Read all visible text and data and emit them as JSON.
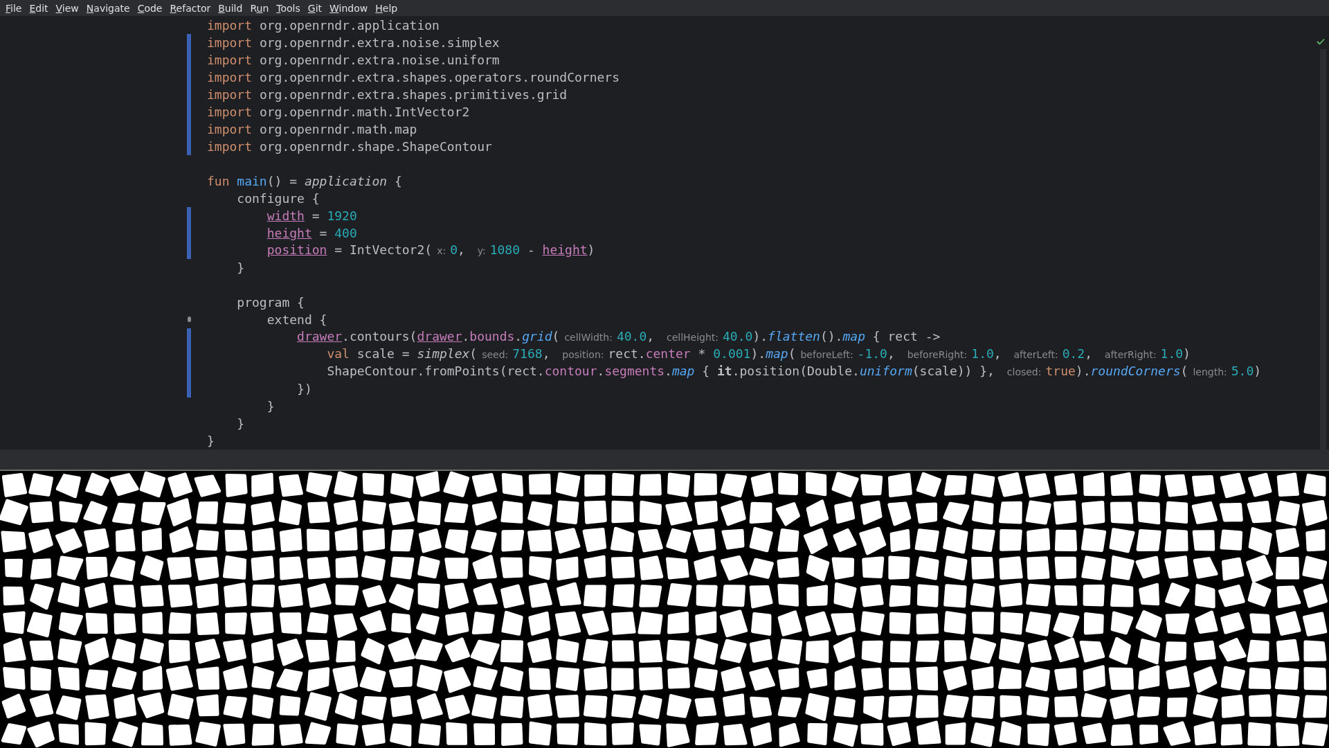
{
  "menu": [
    {
      "key": "F",
      "after": "ile"
    },
    {
      "key": "E",
      "after": "dit"
    },
    {
      "key": "V",
      "after": "iew"
    },
    {
      "key": "N",
      "after": "avigate"
    },
    {
      "key": "C",
      "after": "ode"
    },
    {
      "key": "R",
      "after": "efactor"
    },
    {
      "key": "B",
      "after": "uild"
    },
    {
      "before": "R",
      "key": "u",
      "after": "n"
    },
    {
      "key": "T",
      "after": "ools"
    },
    {
      "key": "G",
      "after": "it"
    },
    {
      "key": "W",
      "after": "indow"
    },
    {
      "key": "H",
      "after": "elp"
    }
  ],
  "editor": {
    "lines": [
      {
        "changed": false,
        "marked": false,
        "tokens": [
          {
            "kind": "kw",
            "text": "import"
          },
          {
            "kind": "plain",
            "text": " org.openrndr.application"
          }
        ]
      },
      {
        "changed": true,
        "marked": false,
        "tokens": [
          {
            "kind": "kw",
            "text": "import"
          },
          {
            "kind": "plain",
            "text": " org.openrndr.extra.noise.simplex"
          }
        ]
      },
      {
        "changed": true,
        "marked": false,
        "tokens": [
          {
            "kind": "kw",
            "text": "import"
          },
          {
            "kind": "plain",
            "text": " org.openrndr.extra.noise.uniform"
          }
        ]
      },
      {
        "changed": true,
        "marked": false,
        "tokens": [
          {
            "kind": "kw",
            "text": "import"
          },
          {
            "kind": "plain",
            "text": " org.openrndr.extra.shapes.operators.roundCorners"
          }
        ]
      },
      {
        "changed": true,
        "marked": false,
        "tokens": [
          {
            "kind": "kw",
            "text": "import"
          },
          {
            "kind": "plain",
            "text": " org.openrndr.extra.shapes.primitives.grid"
          }
        ]
      },
      {
        "changed": true,
        "marked": false,
        "tokens": [
          {
            "kind": "kw",
            "text": "import"
          },
          {
            "kind": "plain",
            "text": " org.openrndr.math.IntVector2"
          }
        ]
      },
      {
        "changed": true,
        "marked": false,
        "tokens": [
          {
            "kind": "kw",
            "text": "import"
          },
          {
            "kind": "plain",
            "text": " org.openrndr.math.map"
          }
        ]
      },
      {
        "changed": true,
        "marked": false,
        "tokens": [
          {
            "kind": "kw",
            "text": "import"
          },
          {
            "kind": "plain",
            "text": " org.openrndr.shape.ShapeContour"
          }
        ]
      },
      {
        "changed": false,
        "marked": false
      },
      {
        "changed": false,
        "marked": false,
        "tokens": [
          {
            "kind": "kw",
            "text": "fun"
          },
          {
            "kind": "fn",
            "text": " main"
          },
          {
            "kind": "plain",
            "text": "() = "
          },
          {
            "kind": "ital",
            "text": "application"
          },
          {
            "kind": "plain",
            "text": " {"
          }
        ]
      },
      {
        "changed": false,
        "marked": false,
        "tokens": [
          {
            "kind": "plain",
            "text": "    configure {"
          }
        ]
      },
      {
        "changed": true,
        "marked": false,
        "tokens": [
          {
            "kind": "prop",
            "text": "        width"
          },
          {
            "kind": "plain",
            "text": " = "
          },
          {
            "kind": "num",
            "text": "1920"
          }
        ]
      },
      {
        "changed": true,
        "marked": false,
        "tokens": [
          {
            "kind": "prop",
            "text": "        height"
          },
          {
            "kind": "plain",
            "text": " = "
          },
          {
            "kind": "num",
            "text": "400"
          }
        ]
      },
      {
        "changed": true,
        "marked": false,
        "tokens": [
          {
            "kind": "prop",
            "text": "        position"
          },
          {
            "kind": "plain",
            "text": " = IntVector2("
          },
          {
            "kind": "hint",
            "text": "x:"
          },
          {
            "kind": "num",
            "text": "0"
          },
          {
            "kind": "plain",
            "text": ", "
          },
          {
            "kind": "hint",
            "text": "y:"
          },
          {
            "kind": "num",
            "text": "1080"
          },
          {
            "kind": "plain",
            "text": " - "
          },
          {
            "kind": "prop",
            "text": "height"
          },
          {
            "kind": "plain",
            "text": ")"
          }
        ]
      },
      {
        "changed": false,
        "marked": false,
        "tokens": [
          {
            "kind": "plain",
            "text": "    }"
          }
        ]
      },
      {
        "changed": false,
        "marked": false
      },
      {
        "changed": false,
        "marked": false,
        "tokens": [
          {
            "kind": "plain",
            "text": "    program {"
          }
        ]
      },
      {
        "changed": false,
        "marked": true,
        "tokens": [
          {
            "kind": "plain",
            "text": "        extend {"
          }
        ]
      },
      {
        "changed": true,
        "marked": false,
        "tokens": [
          {
            "kind": "prop",
            "text": "            drawer"
          },
          {
            "kind": "plain",
            "text": ".contours("
          },
          {
            "kind": "prop",
            "text": "drawer"
          },
          {
            "kind": "plain",
            "text": "."
          },
          {
            "kind": "field",
            "text": "bounds"
          },
          {
            "kind": "plain",
            "text": "."
          },
          {
            "kind": "itfn",
            "text": "grid"
          },
          {
            "kind": "plain",
            "text": "("
          },
          {
            "kind": "hint",
            "text": "cellWidth:"
          },
          {
            "kind": "num",
            "text": "40.0"
          },
          {
            "kind": "plain",
            "text": ", "
          },
          {
            "kind": "hint",
            "text": "cellHeight:"
          },
          {
            "kind": "num",
            "text": "40.0"
          },
          {
            "kind": "plain",
            "text": ")."
          },
          {
            "kind": "itfn",
            "text": "flatten"
          },
          {
            "kind": "plain",
            "text": "()."
          },
          {
            "kind": "itfn",
            "text": "map"
          },
          {
            "kind": "plain",
            "text": " { rect ->"
          }
        ]
      },
      {
        "changed": true,
        "marked": false,
        "tokens": [
          {
            "kind": "kw",
            "text": "                val"
          },
          {
            "kind": "plain",
            "text": " scale = "
          },
          {
            "kind": "ital",
            "text": "simplex"
          },
          {
            "kind": "plain",
            "text": "("
          },
          {
            "kind": "hint",
            "text": "seed:"
          },
          {
            "kind": "num",
            "text": "7168"
          },
          {
            "kind": "plain",
            "text": ", "
          },
          {
            "kind": "hint",
            "text": "position:"
          },
          {
            "kind": "plain",
            "text": "rect."
          },
          {
            "kind": "field",
            "text": "center"
          },
          {
            "kind": "plain",
            "text": " * "
          },
          {
            "kind": "num",
            "text": "0.001"
          },
          {
            "kind": "plain",
            "text": ")."
          },
          {
            "kind": "itfn",
            "text": "map"
          },
          {
            "kind": "plain",
            "text": "("
          },
          {
            "kind": "hint",
            "text": "beforeLeft:"
          },
          {
            "kind": "num",
            "text": "-1.0"
          },
          {
            "kind": "plain",
            "text": ", "
          },
          {
            "kind": "hint",
            "text": "beforeRight:"
          },
          {
            "kind": "num",
            "text": "1.0"
          },
          {
            "kind": "plain",
            "text": ", "
          },
          {
            "kind": "hint",
            "text": "afterLeft:"
          },
          {
            "kind": "num",
            "text": "0.2"
          },
          {
            "kind": "plain",
            "text": ", "
          },
          {
            "kind": "hint",
            "text": "afterRight:"
          },
          {
            "kind": "num",
            "text": "1.0"
          },
          {
            "kind": "plain",
            "text": ")"
          }
        ]
      },
      {
        "changed": true,
        "marked": false,
        "tokens": [
          {
            "kind": "plain",
            "text": "                ShapeContour.fromPoints(rect."
          },
          {
            "kind": "field",
            "text": "contour"
          },
          {
            "kind": "plain",
            "text": "."
          },
          {
            "kind": "field",
            "text": "segments"
          },
          {
            "kind": "plain",
            "text": "."
          },
          {
            "kind": "itfn",
            "text": "map"
          },
          {
            "kind": "plain",
            "text": " { "
          },
          {
            "kind": "bold",
            "text": "it"
          },
          {
            "kind": "plain",
            "text": ".position(Double."
          },
          {
            "kind": "itfn",
            "text": "uniform"
          },
          {
            "kind": "plain",
            "text": "(scale)) }, "
          },
          {
            "kind": "hint",
            "text": "closed:"
          },
          {
            "kind": "kw",
            "text": "true"
          },
          {
            "kind": "plain",
            "text": ")."
          },
          {
            "kind": "itfn",
            "text": "roundCorners"
          },
          {
            "kind": "plain",
            "text": "("
          },
          {
            "kind": "hint",
            "text": "length:"
          },
          {
            "kind": "num",
            "text": "5.0"
          },
          {
            "kind": "plain",
            "text": ")"
          }
        ]
      },
      {
        "changed": true,
        "marked": false,
        "tokens": [
          {
            "kind": "plain",
            "text": "            })"
          }
        ]
      },
      {
        "changed": false,
        "marked": false,
        "tokens": [
          {
            "kind": "plain",
            "text": "        }"
          }
        ]
      },
      {
        "changed": false,
        "marked": false,
        "tokens": [
          {
            "kind": "plain",
            "text": "    }"
          }
        ]
      },
      {
        "changed": false,
        "marked": false,
        "tokens": [
          {
            "kind": "plain",
            "text": "}"
          }
        ]
      }
    ]
  }
}
